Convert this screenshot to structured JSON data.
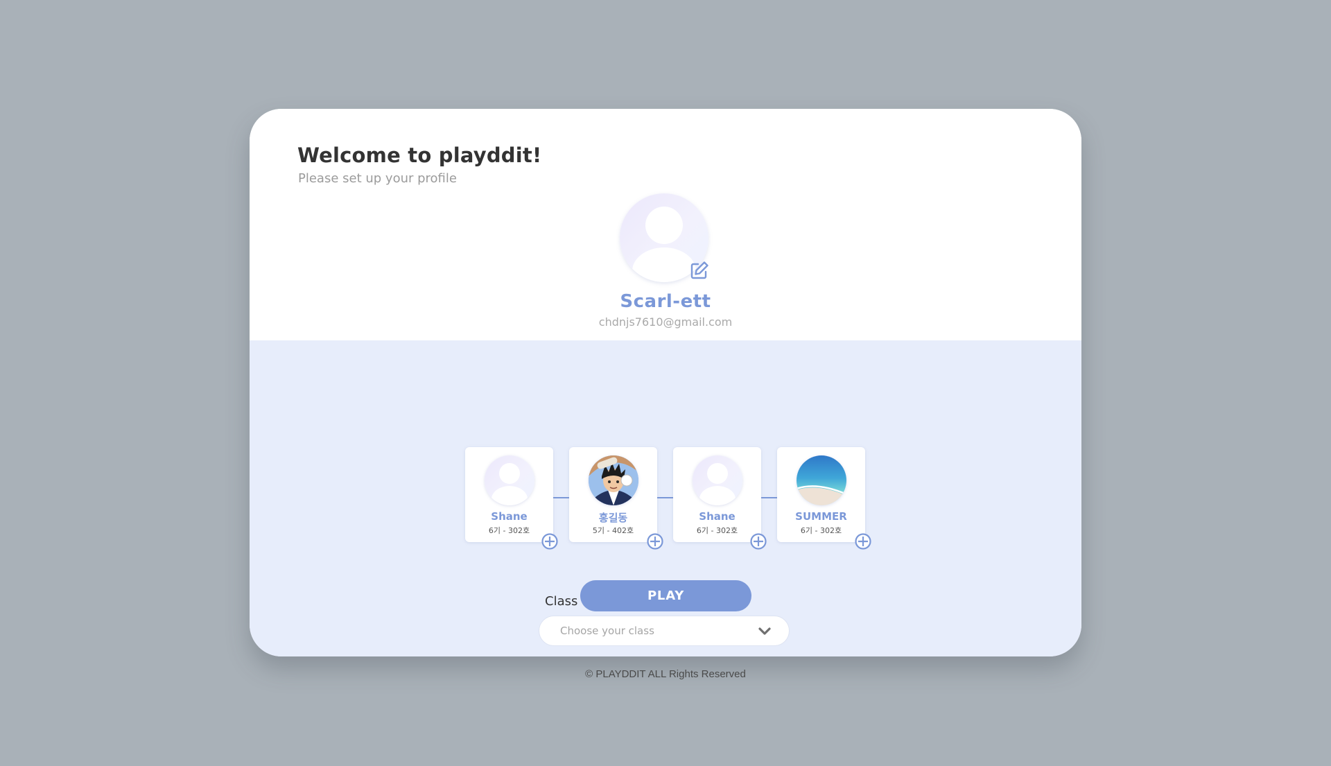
{
  "welcome": {
    "title": "Welcome to playddit!",
    "subtitle": "Please set up your profile"
  },
  "profile": {
    "name": "Scarl-ett",
    "email": "chdnjs7610@gmail.com",
    "avatar_icon": "default-user-icon",
    "edit_icon": "pencil-square-icon"
  },
  "class_select": {
    "label": "Class",
    "placeholder": "Choose your class",
    "icon": "chevron-down-icon"
  },
  "members": [
    {
      "name": "Shane",
      "sub": "6기 - 302호",
      "avatar": "default-user"
    },
    {
      "name": "홍길동",
      "sub": "5기 - 402호",
      "avatar": "cartoon-character"
    },
    {
      "name": "Shane",
      "sub": "6기 - 302호",
      "avatar": "default-user"
    },
    {
      "name": "SUMMER",
      "sub": "6기 - 302호",
      "avatar": "beach-photo"
    }
  ],
  "play_button": {
    "label": "PLAY"
  },
  "footer": {
    "text": "© PLAYDDIT ALL Rights Reserved"
  },
  "colors": {
    "accent": "#7b98d8",
    "page_background": "#a9b1b8",
    "panel_background": "#e7edfb"
  }
}
